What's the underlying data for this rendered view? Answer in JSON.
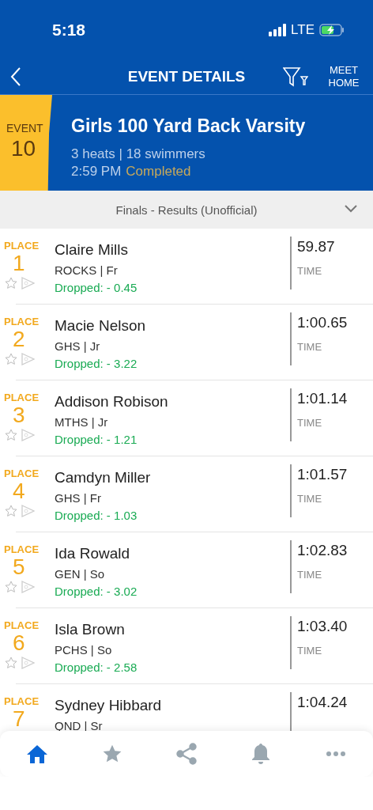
{
  "status_bar": {
    "time": "5:18",
    "network": "LTE"
  },
  "nav": {
    "title": "EVENT DETAILS",
    "meet_home": [
      "MEET",
      "HOME"
    ]
  },
  "event": {
    "label": "EVENT",
    "number": "10",
    "name": "Girls 100 Yard Back Varsity",
    "summary": "3 heats | 18 swimmers",
    "time": "2:59 PM",
    "status": "Completed"
  },
  "section": {
    "title": "Finals - Results (Unofficial)"
  },
  "results": [
    {
      "place_label": "PLACE",
      "place": "1",
      "name": "Claire Mills",
      "team": "ROCKS | Fr",
      "dropped": "Dropped: - 0.45",
      "time": "59.87",
      "time_label": "TIME",
      "favorite": false
    },
    {
      "place_label": "PLACE",
      "place": "2",
      "name": "Macie Nelson",
      "team": "GHS | Jr",
      "dropped": "Dropped: - 3.22",
      "time": "1:00.65",
      "time_label": "TIME",
      "favorite": false
    },
    {
      "place_label": "PLACE",
      "place": "3",
      "name": "Addison Robison",
      "team": "MTHS | Jr",
      "dropped": "Dropped: - 1.21",
      "time": "1:01.14",
      "time_label": "TIME",
      "favorite": false
    },
    {
      "place_label": "PLACE",
      "place": "4",
      "name": "Camdyn Miller",
      "team": "GHS | Fr",
      "dropped": "Dropped: - 1.03",
      "time": "1:01.57",
      "time_label": "TIME",
      "favorite": false
    },
    {
      "place_label": "PLACE",
      "place": "5",
      "name": "Ida Rowald",
      "team": "GEN | So",
      "dropped": "Dropped: - 3.02",
      "time": "1:02.83",
      "time_label": "TIME",
      "favorite": false
    },
    {
      "place_label": "PLACE",
      "place": "6",
      "name": "Isla Brown",
      "team": "PCHS | So",
      "dropped": "Dropped: - 2.58",
      "time": "1:03.40",
      "time_label": "TIME",
      "favorite": false
    },
    {
      "place_label": "PLACE",
      "place": "7",
      "name": "Sydney Hibbard",
      "team": "QND | Sr",
      "time": "1:04.24"
    }
  ],
  "tab_bar": [
    {
      "kind": "home",
      "selected": true
    },
    {
      "kind": "favorites",
      "selected": false
    },
    {
      "kind": "share",
      "selected": false
    },
    {
      "kind": "alerts",
      "selected": false
    },
    {
      "kind": "more",
      "selected": false
    }
  ]
}
